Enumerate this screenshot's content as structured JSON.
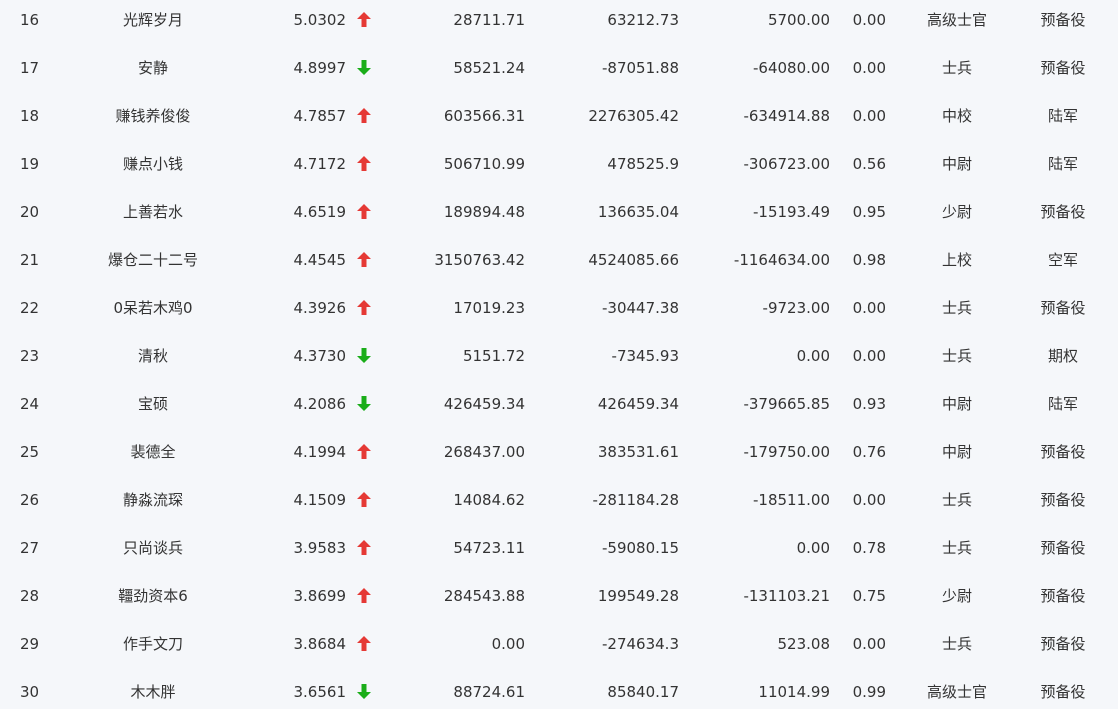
{
  "colors": {
    "background": "#f5f7fa",
    "text": "#333333",
    "up": "#e53935",
    "down": "#1aad19"
  },
  "rows": [
    {
      "rank": "16",
      "name": "光辉岁月",
      "score": "5.0302",
      "trend": "up",
      "v1": "28711.71",
      "v2": "63212.73",
      "v3": "5700.00",
      "v4": "0.00",
      "title": "高级士官",
      "branch": "预备役"
    },
    {
      "rank": "17",
      "name": "安静",
      "score": "4.8997",
      "trend": "down",
      "v1": "58521.24",
      "v2": "-87051.88",
      "v3": "-64080.00",
      "v4": "0.00",
      "title": "士兵",
      "branch": "预备役"
    },
    {
      "rank": "18",
      "name": "赚钱养俊俊",
      "score": "4.7857",
      "trend": "up",
      "v1": "603566.31",
      "v2": "2276305.42",
      "v3": "-634914.88",
      "v4": "0.00",
      "title": "中校",
      "branch": "陆军"
    },
    {
      "rank": "19",
      "name": "赚点小钱",
      "score": "4.7172",
      "trend": "up",
      "v1": "506710.99",
      "v2": "478525.9",
      "v3": "-306723.00",
      "v4": "0.56",
      "title": "中尉",
      "branch": "陆军"
    },
    {
      "rank": "20",
      "name": "上善若水",
      "score": "4.6519",
      "trend": "up",
      "v1": "189894.48",
      "v2": "136635.04",
      "v3": "-15193.49",
      "v4": "0.95",
      "title": "少尉",
      "branch": "预备役"
    },
    {
      "rank": "21",
      "name": "爆仓二十二号",
      "score": "4.4545",
      "trend": "up",
      "v1": "3150763.42",
      "v2": "4524085.66",
      "v3": "-1164634.00",
      "v4": "0.98",
      "title": "上校",
      "branch": "空军"
    },
    {
      "rank": "22",
      "name": "0呆若木鸡0",
      "score": "4.3926",
      "trend": "up",
      "v1": "17019.23",
      "v2": "-30447.38",
      "v3": "-9723.00",
      "v4": "0.00",
      "title": "士兵",
      "branch": "预备役"
    },
    {
      "rank": "23",
      "name": "清秋",
      "score": "4.3730",
      "trend": "down",
      "v1": "5151.72",
      "v2": "-7345.93",
      "v3": "0.00",
      "v4": "0.00",
      "title": "士兵",
      "branch": "期权"
    },
    {
      "rank": "24",
      "name": "宝硕",
      "score": "4.2086",
      "trend": "down",
      "v1": "426459.34",
      "v2": "426459.34",
      "v3": "-379665.85",
      "v4": "0.93",
      "title": "中尉",
      "branch": "陆军"
    },
    {
      "rank": "25",
      "name": "裴德全",
      "score": "4.1994",
      "trend": "up",
      "v1": "268437.00",
      "v2": "383531.61",
      "v3": "-179750.00",
      "v4": "0.76",
      "title": "中尉",
      "branch": "预备役"
    },
    {
      "rank": "26",
      "name": "静淼流琛",
      "score": "4.1509",
      "trend": "up",
      "v1": "14084.62",
      "v2": "-281184.28",
      "v3": "-18511.00",
      "v4": "0.00",
      "title": "士兵",
      "branch": "预备役"
    },
    {
      "rank": "27",
      "name": "只尚谈兵",
      "score": "3.9583",
      "trend": "up",
      "v1": "54723.11",
      "v2": "-59080.15",
      "v3": "0.00",
      "v4": "0.78",
      "title": "士兵",
      "branch": "预备役"
    },
    {
      "rank": "28",
      "name": "韁劲资本6",
      "score": "3.8699",
      "trend": "up",
      "v1": "284543.88",
      "v2": "199549.28",
      "v3": "-131103.21",
      "v4": "0.75",
      "title": "少尉",
      "branch": "预备役"
    },
    {
      "rank": "29",
      "name": "作手文刀",
      "score": "3.8684",
      "trend": "up",
      "v1": "0.00",
      "v2": "-274634.3",
      "v3": "523.08",
      "v4": "0.00",
      "title": "士兵",
      "branch": "预备役"
    },
    {
      "rank": "30",
      "name": "木木胖",
      "score": "3.6561",
      "trend": "down",
      "v1": "88724.61",
      "v2": "85840.17",
      "v3": "11014.99",
      "v4": "0.99",
      "title": "高级士官",
      "branch": "预备役"
    }
  ]
}
